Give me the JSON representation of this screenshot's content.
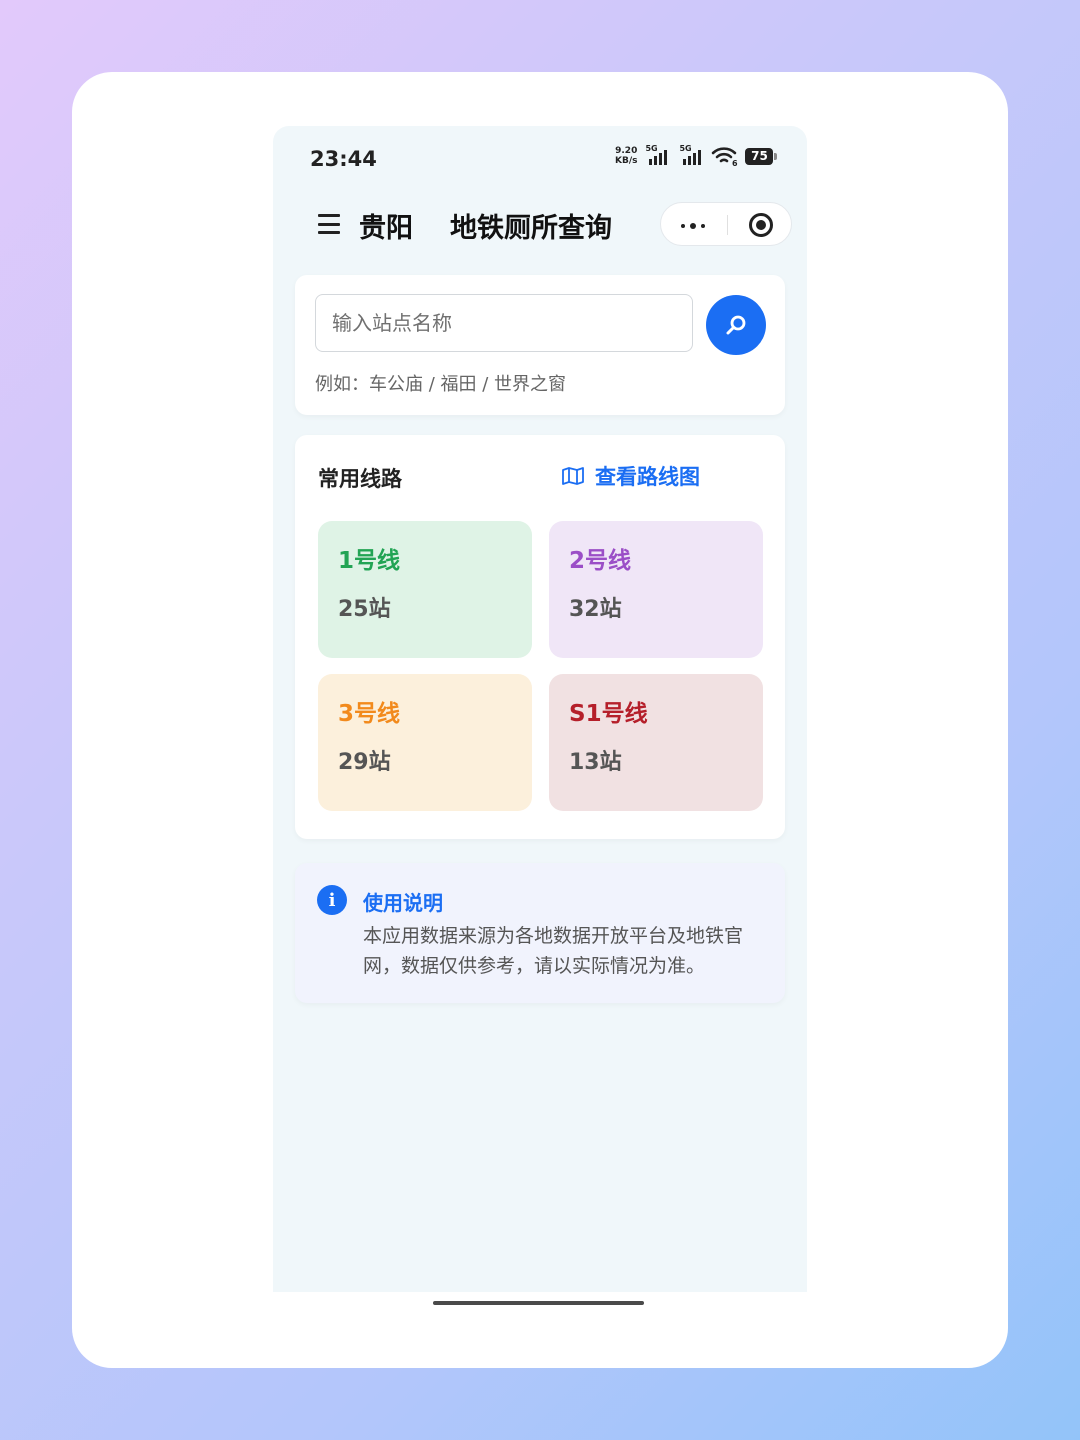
{
  "status_bar": {
    "time": "23:44",
    "net_speed_value": "9.20",
    "net_speed_unit": "KB/s",
    "sim1_label": "5G",
    "sim2_label": "5G",
    "wifi_label": "6",
    "battery_level": "75"
  },
  "nav": {
    "city": "贵阳",
    "title": "地铁厕所查询"
  },
  "search": {
    "placeholder": "输入站点名称",
    "value": "",
    "hint": "例如：车公庙 / 福田 / 世界之窗"
  },
  "lines_section": {
    "title": "常用线路",
    "map_link": "查看路线图",
    "lines": [
      {
        "name": "1号线",
        "stations": "25站",
        "color": "#22a454",
        "bg": "#dff3e6"
      },
      {
        "name": "2号线",
        "stations": "32站",
        "color": "#9b4ec7",
        "bg": "#f0e6f7"
      },
      {
        "name": "3号线",
        "stations": "29站",
        "color": "#f28a1c",
        "bg": "#fcf0dc"
      },
      {
        "name": "S1号线",
        "stations": "13站",
        "color": "#b51f2a",
        "bg": "#f1e1e2"
      }
    ]
  },
  "info": {
    "title": "使用说明",
    "body": "本应用数据来源为各地数据开放平台及地铁官网，数据仅供参考，请以实际情况为准。"
  },
  "colors": {
    "accent": "#1b6ef3",
    "page_bg": "#f0f7fa"
  }
}
